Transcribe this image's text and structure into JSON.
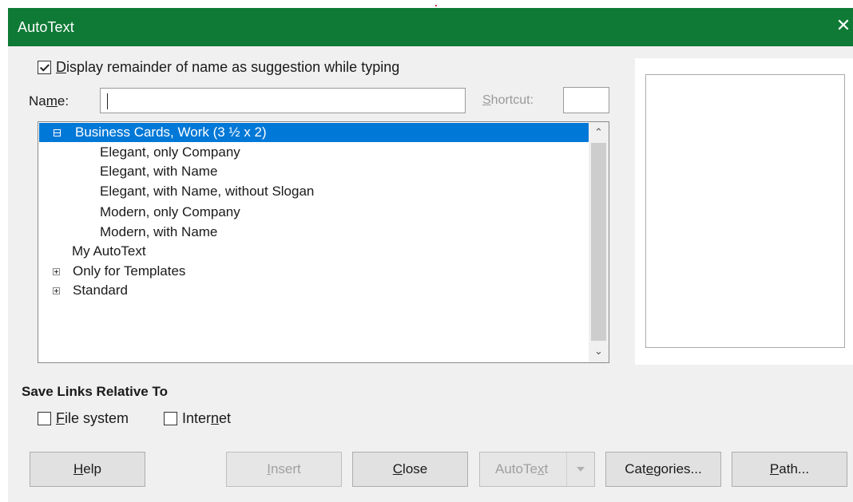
{
  "window": {
    "title": "AutoText",
    "close_glyph": "✕"
  },
  "options": {
    "display_suggestion": {
      "label_pre": "",
      "label_mnemonic": "D",
      "label_post": "isplay remainder of name as suggestion while typing",
      "checked": true
    }
  },
  "name_field": {
    "label_pre": "Na",
    "label_mnemonic": "m",
    "label_post": "e:",
    "value": ""
  },
  "shortcut_field": {
    "label_pre": "",
    "label_mnemonic": "S",
    "label_post": "hortcut:",
    "value": ""
  },
  "tree": {
    "items": [
      {
        "label": "Business Cards, Work (3 ½ x 2)",
        "level": 0,
        "expander": "minus",
        "selected": true
      },
      {
        "label": "Elegant, only Company",
        "level": 1
      },
      {
        "label": "Elegant, with Name",
        "level": 1
      },
      {
        "label": "Elegant, with Name, without Slogan",
        "level": 1
      },
      {
        "label": "Modern, only Company",
        "level": 1
      },
      {
        "label": "Modern, with Name",
        "level": 1
      },
      {
        "label": "My AutoText",
        "level": 0,
        "expander": "none"
      },
      {
        "label": "Only for Templates",
        "level": 0,
        "expander": "plus"
      },
      {
        "label": "Standard",
        "level": 0,
        "expander": "plus"
      }
    ],
    "scroll_up": "⌃",
    "scroll_down": "⌄"
  },
  "save_links": {
    "title": "Save Links Relative To",
    "file_system": {
      "label_pre": "",
      "label_mnemonic": "F",
      "label_post": "ile system",
      "checked": false
    },
    "internet": {
      "label_pre": "Inter",
      "label_mnemonic": "n",
      "label_post": "et",
      "checked": false
    }
  },
  "buttons": {
    "help": {
      "pre": "",
      "mn": "H",
      "post": "elp"
    },
    "insert": {
      "pre": "",
      "mn": "I",
      "post": "nsert"
    },
    "close": {
      "pre": "",
      "mn": "C",
      "post": "lose"
    },
    "autotext": {
      "pre": "AutoTe",
      "mn": "x",
      "post": "t"
    },
    "categories": {
      "pre": "Cat",
      "mn": "e",
      "post": "gories..."
    },
    "path": {
      "pre": "",
      "mn": "P",
      "post": "ath..."
    }
  },
  "colors": {
    "titlebar": "#0f7a36",
    "selection": "#0078d7",
    "dialog_bg": "#f0f0f0"
  }
}
